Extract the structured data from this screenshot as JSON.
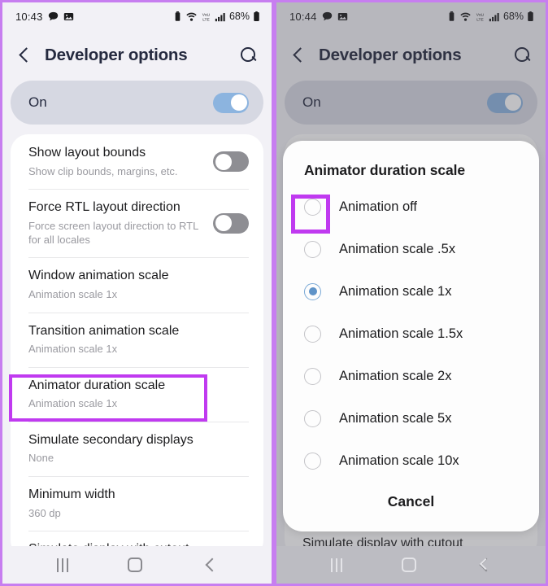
{
  "accent_highlight_color": "#c03af0",
  "panel_border_color": "#c77ef0",
  "toggle_on_color": "#8cb4df",
  "toggle_off_color": "#8e8e93",
  "radio_selected_color": "#5e93c8",
  "left_panel": {
    "status_bar": {
      "time": "10:43",
      "battery_percent": "68%",
      "icons": [
        "chat-bubble-icon",
        "photo-icon",
        "alarm-icon",
        "wifi-calling-icon",
        "volte-icon",
        "signal-bars-icon",
        "battery-icon"
      ]
    },
    "app_bar": {
      "back_label": "back-chevron",
      "title": "Developer options",
      "search_label": "search"
    },
    "master_switch": {
      "label": "On",
      "state": "on"
    },
    "settings": [
      {
        "title": "Show layout bounds",
        "subtitle": "Show clip bounds, margins, etc.",
        "control": "toggle",
        "state": "off"
      },
      {
        "title": "Force RTL layout direction",
        "subtitle": "Force screen layout direction to RTL for all locales",
        "control": "toggle",
        "state": "off"
      },
      {
        "title": "Window animation scale",
        "subtitle": "Animation scale 1x",
        "control": "none"
      },
      {
        "title": "Transition animation scale",
        "subtitle": "Animation scale 1x",
        "control": "none"
      },
      {
        "title": "Animator duration scale",
        "subtitle": "Animation scale 1x",
        "control": "none",
        "highlighted": true
      },
      {
        "title": "Simulate secondary displays",
        "subtitle": "None",
        "control": "none"
      },
      {
        "title": "Minimum width",
        "subtitle": "360 dp",
        "control": "none"
      },
      {
        "title": "Simulate display with cutout",
        "subtitle": "",
        "control": "none",
        "clipped": true
      }
    ],
    "nav_bar": {
      "recents": "recents-icon",
      "home": "home-icon",
      "back": "back-icon"
    }
  },
  "right_panel": {
    "status_bar": {
      "time": "10:44",
      "battery_percent": "68%"
    },
    "app_bar": {
      "title": "Developer options"
    },
    "master_switch": {
      "label": "On",
      "state": "on"
    },
    "background_item": {
      "title": "Simulate display with cutout"
    },
    "dialog": {
      "title": "Animator duration scale",
      "options": [
        {
          "label": "Animation off",
          "selected": false,
          "highlighted": true
        },
        {
          "label": "Animation scale .5x",
          "selected": false
        },
        {
          "label": "Animation scale 1x",
          "selected": true
        },
        {
          "label": "Animation scale 1.5x",
          "selected": false
        },
        {
          "label": "Animation scale 2x",
          "selected": false
        },
        {
          "label": "Animation scale 5x",
          "selected": false
        },
        {
          "label": "Animation scale 10x",
          "selected": false
        }
      ],
      "cancel_label": "Cancel"
    },
    "nav_bar": {
      "recents": "recents-icon",
      "home": "home-icon",
      "back": "back-icon"
    }
  }
}
